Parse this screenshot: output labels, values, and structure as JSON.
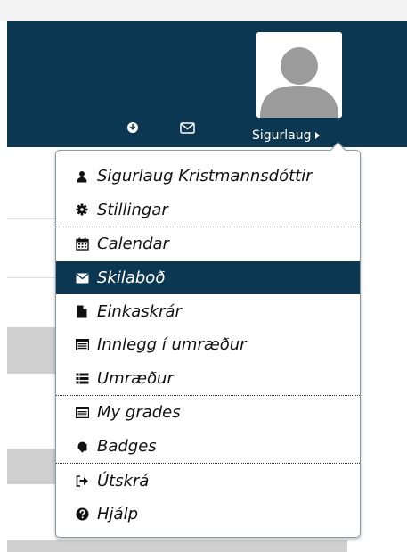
{
  "navbar": {
    "user_name": "Sigurlaug",
    "colors": {
      "navbar_bg": "#0c3752",
      "active_item_bg": "#0c3752"
    },
    "icons": [
      "notification-icon",
      "messages-icon",
      "avatar-icon",
      "caret-right-icon"
    ]
  },
  "user_menu": {
    "items": [
      {
        "label": "Sigurlaug Kristmannsdóttir",
        "icon": "user-icon"
      },
      {
        "label": "Stillingar",
        "icon": "gear-icon"
      },
      {
        "label": "Calendar",
        "icon": "calendar-icon"
      },
      {
        "label": "Skilaboð",
        "icon": "envelope-icon",
        "active": true
      },
      {
        "label": "Einkaskrár",
        "icon": "file-icon"
      },
      {
        "label": "Innlegg í umræður",
        "icon": "posts-icon"
      },
      {
        "label": "Umræður",
        "icon": "list-icon"
      },
      {
        "label": "My grades",
        "icon": "grades-icon"
      },
      {
        "label": "Badges",
        "icon": "badge-icon"
      },
      {
        "label": "Útskrá",
        "icon": "logout-icon"
      },
      {
        "label": "Hjálp",
        "icon": "help-icon"
      }
    ]
  }
}
